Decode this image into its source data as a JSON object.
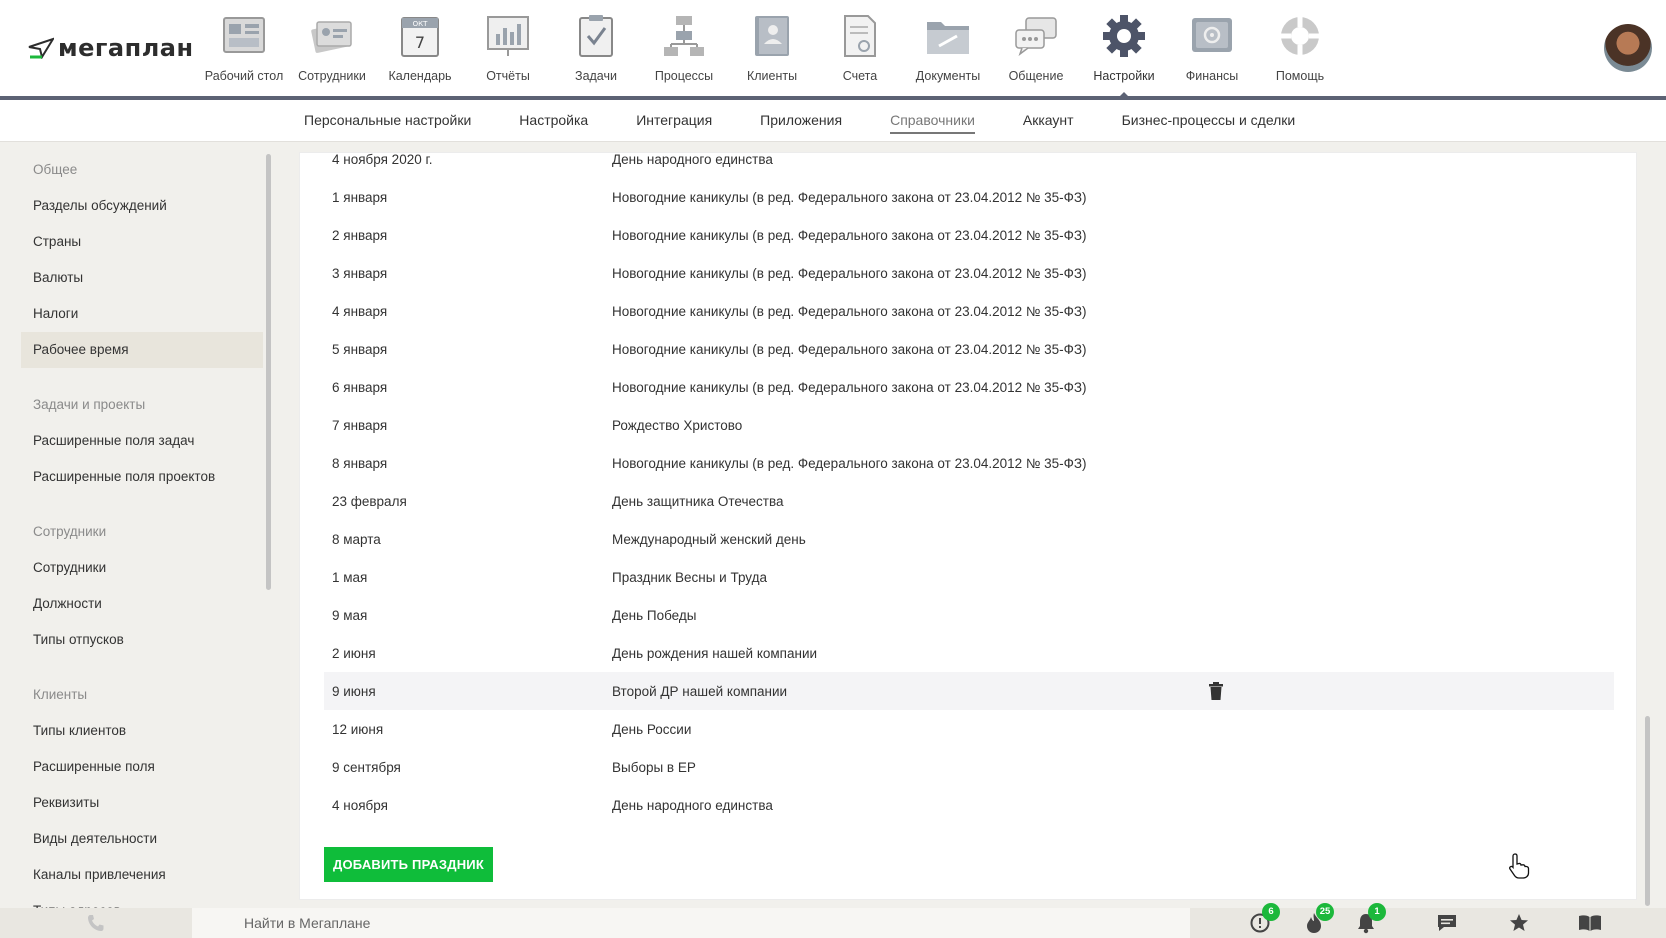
{
  "app": {
    "logo_text": "мегаплан"
  },
  "nav": {
    "items": [
      {
        "label": "Рабочий стол",
        "icon": "desktop-icon"
      },
      {
        "label": "Сотрудники",
        "icon": "employees-icon"
      },
      {
        "label": "Календарь",
        "icon": "calendar-icon",
        "month": "ОКТ",
        "day": "7"
      },
      {
        "label": "Отчёты",
        "icon": "reports-icon"
      },
      {
        "label": "Задачи",
        "icon": "tasks-icon"
      },
      {
        "label": "Процессы",
        "icon": "processes-icon"
      },
      {
        "label": "Клиенты",
        "icon": "clients-icon"
      },
      {
        "label": "Счета",
        "icon": "invoices-icon"
      },
      {
        "label": "Документы",
        "icon": "documents-icon"
      },
      {
        "label": "Общение",
        "icon": "chat-icon"
      },
      {
        "label": "Настройки",
        "icon": "gear-icon",
        "active": true
      },
      {
        "label": "Финансы",
        "icon": "safe-icon"
      },
      {
        "label": "Помощь",
        "icon": "lifebuoy-icon"
      }
    ]
  },
  "subnav": {
    "items": [
      "Персональные настройки",
      "Настройка",
      "Интеграция",
      "Приложения",
      "Справочники",
      "Аккаунт",
      "Бизнес-процессы и сделки"
    ],
    "active_index": 4
  },
  "sidebar": {
    "groups": [
      {
        "title": "Общее",
        "items": [
          "Разделы обсуждений",
          "Страны",
          "Валюты",
          "Налоги",
          "Рабочее время"
        ]
      },
      {
        "title": "Задачи и проекты",
        "items": [
          "Расширенные поля задач",
          "Расширенные поля проектов"
        ]
      },
      {
        "title": "Сотрудники",
        "items": [
          "Сотрудники",
          "Должности",
          "Типы отпусков"
        ]
      },
      {
        "title": "Клиенты",
        "items": [
          "Типы клиентов",
          "Расширенные поля",
          "Реквизиты",
          "Виды деятельности",
          "Каналы привлечения",
          "Типы адресов"
        ]
      }
    ],
    "active_item": "Рабочее время"
  },
  "holidays": [
    {
      "date": "4 ноября 2020 г.",
      "name": "День народного единства"
    },
    {
      "date": "1 января",
      "name": "Новогодние каникулы (в ред. Федерального закона от 23.04.2012 № 35-ФЗ)"
    },
    {
      "date": "2 января",
      "name": "Новогодние каникулы (в ред. Федерального закона от 23.04.2012 № 35-ФЗ)"
    },
    {
      "date": "3 января",
      "name": "Новогодние каникулы (в ред. Федерального закона от 23.04.2012 № 35-ФЗ)"
    },
    {
      "date": "4 января",
      "name": "Новогодние каникулы (в ред. Федерального закона от 23.04.2012 № 35-ФЗ)"
    },
    {
      "date": "5 января",
      "name": "Новогодние каникулы (в ред. Федерального закона от 23.04.2012 № 35-ФЗ)"
    },
    {
      "date": "6 января",
      "name": "Новогодние каникулы (в ред. Федерального закона от 23.04.2012 № 35-ФЗ)"
    },
    {
      "date": "7 января",
      "name": "Рождество Христово"
    },
    {
      "date": "8 января",
      "name": "Новогодние каникулы (в ред. Федерального закона от 23.04.2012 № 35-ФЗ)"
    },
    {
      "date": "23 февраля",
      "name": "День защитника Отечества"
    },
    {
      "date": "8 марта",
      "name": "Международный женский день"
    },
    {
      "date": "1 мая",
      "name": "Праздник Весны и Труда"
    },
    {
      "date": "9 мая",
      "name": "День Победы"
    },
    {
      "date": "2 июня",
      "name": "День рождения нашей компании"
    },
    {
      "date": "9 июня",
      "name": "Второй ДР нашей компании",
      "hovered": true
    },
    {
      "date": "12 июня",
      "name": "День России"
    },
    {
      "date": "9 сентября",
      "name": "Выборы в ЕР"
    },
    {
      "date": "4 ноября",
      "name": "День народного единства"
    }
  ],
  "add_button": "ДОБАВИТЬ ПРАЗДНИК",
  "bottombar": {
    "search_placeholder": "Найти в Мегаплане",
    "badges": {
      "alerts": "6",
      "hot": "25",
      "notifications": "1"
    }
  },
  "colors": {
    "accent_green": "#0fbd3a",
    "nav_line": "#5c6274",
    "badge_green": "#1cb83b"
  }
}
